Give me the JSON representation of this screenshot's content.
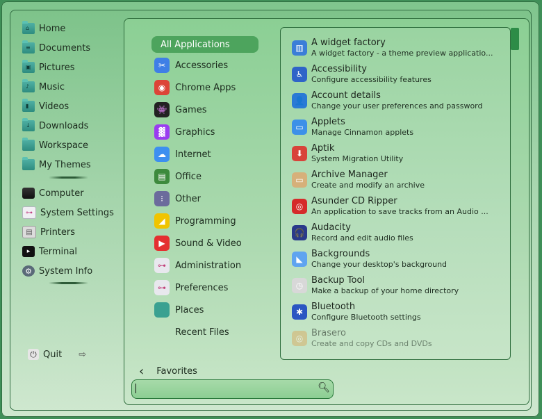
{
  "left": {
    "places": [
      {
        "label": "Home",
        "icon": "home-folder-icon",
        "glyph": "⌂"
      },
      {
        "label": "Documents",
        "icon": "documents-folder-icon",
        "glyph": "≡"
      },
      {
        "label": "Pictures",
        "icon": "pictures-folder-icon",
        "glyph": "▣"
      },
      {
        "label": "Music",
        "icon": "music-folder-icon",
        "glyph": "♪"
      },
      {
        "label": "Videos",
        "icon": "videos-folder-icon",
        "glyph": "▮"
      },
      {
        "label": "Downloads",
        "icon": "downloads-folder-icon",
        "glyph": "↓"
      },
      {
        "label": "Workspace",
        "icon": "folder-icon",
        "glyph": ""
      },
      {
        "label": "My Themes",
        "icon": "folder-icon",
        "glyph": ""
      }
    ],
    "system": [
      {
        "label": "Computer",
        "icon": "computer-icon"
      },
      {
        "label": "System Settings",
        "icon": "settings-icon"
      },
      {
        "label": "Printers",
        "icon": "printer-icon"
      },
      {
        "label": "Terminal",
        "icon": "terminal-icon"
      },
      {
        "label": "System Info",
        "icon": "gear-icon"
      }
    ],
    "quit_label": "Quit"
  },
  "categories": [
    {
      "label": "All Applications",
      "icon": "",
      "selected": true
    },
    {
      "label": "Accessories",
      "icon": "accessories-icon",
      "color": "#3f7fe6",
      "glyph": "✂"
    },
    {
      "label": "Chrome Apps",
      "icon": "chrome-icon",
      "color": "#dc4437",
      "glyph": "◉"
    },
    {
      "label": "Games",
      "icon": "games-icon",
      "color": "#222222",
      "glyph": "👾"
    },
    {
      "label": "Graphics",
      "icon": "graphics-icon",
      "color": "#9a3cf0",
      "glyph": "▓"
    },
    {
      "label": "Internet",
      "icon": "internet-icon",
      "color": "#3d8ff0",
      "glyph": "☁"
    },
    {
      "label": "Office",
      "icon": "office-icon",
      "color": "#3d8a3d",
      "glyph": "▤"
    },
    {
      "label": "Other",
      "icon": "other-icon",
      "color": "#6b6b9c",
      "glyph": "⁝"
    },
    {
      "label": "Programming",
      "icon": "programming-icon",
      "color": "#f0c400",
      "glyph": "◢"
    },
    {
      "label": "Sound & Video",
      "icon": "sound-video-icon",
      "color": "#e43030",
      "glyph": "▶"
    },
    {
      "label": "Administration",
      "icon": "administration-icon",
      "color": "#e8e8ee",
      "glyph": "⊶"
    },
    {
      "label": "Preferences",
      "icon": "preferences-icon",
      "color": "#e8e8ee",
      "glyph": "⊶"
    },
    {
      "label": "Places",
      "icon": "places-icon",
      "color": "#3aa191",
      "glyph": ""
    },
    {
      "label": "Recent Files",
      "icon": "",
      "color": "transparent",
      "glyph": ""
    }
  ],
  "apps": [
    {
      "title": "A widget factory",
      "desc": "A widget factory - a theme preview applicatio...",
      "icon": "widget-factory-icon",
      "color": "#3b7ed8",
      "glyph": "▥"
    },
    {
      "title": "Accessibility",
      "desc": "Configure accessibility features",
      "icon": "accessibility-icon",
      "color": "#2f64c8",
      "glyph": "♿"
    },
    {
      "title": "Account details",
      "desc": "Change your user preferences and password",
      "icon": "account-icon",
      "color": "#2a7ad5",
      "glyph": "👤"
    },
    {
      "title": "Applets",
      "desc": "Manage Cinnamon applets",
      "icon": "applets-icon",
      "color": "#3c90e8",
      "glyph": "▭"
    },
    {
      "title": "Aptik",
      "desc": "System Migration Utility",
      "icon": "aptik-icon",
      "color": "#d8433a",
      "glyph": "⬇"
    },
    {
      "title": "Archive Manager",
      "desc": "Create and modify an archive",
      "icon": "archive-icon",
      "color": "#d6b07a",
      "glyph": "▭"
    },
    {
      "title": "Asunder CD Ripper",
      "desc": "An application to save tracks from an Audio ...",
      "icon": "asunder-icon",
      "color": "#d52a2a",
      "glyph": "◎"
    },
    {
      "title": "Audacity",
      "desc": "Record and edit audio files",
      "icon": "audacity-icon",
      "color": "#2a3a8a",
      "glyph": "🎧"
    },
    {
      "title": "Backgrounds",
      "desc": "Change your desktop's background",
      "icon": "backgrounds-icon",
      "color": "#5fa4f0",
      "glyph": "◣"
    },
    {
      "title": "Backup Tool",
      "desc": "Make a backup of your home directory",
      "icon": "backup-icon",
      "color": "#d8d8d8",
      "glyph": "◷"
    },
    {
      "title": "Bluetooth",
      "desc": "Configure Bluetooth settings",
      "icon": "bluetooth-icon",
      "color": "#2b56c2",
      "glyph": "✱"
    },
    {
      "title": "Brasero",
      "desc": "Create and copy CDs and DVDs",
      "icon": "brasero-icon",
      "color": "#d8b06a",
      "glyph": "◎",
      "faded": true
    }
  ],
  "footer": {
    "favorites_label": "Favorites",
    "search_value": ""
  }
}
